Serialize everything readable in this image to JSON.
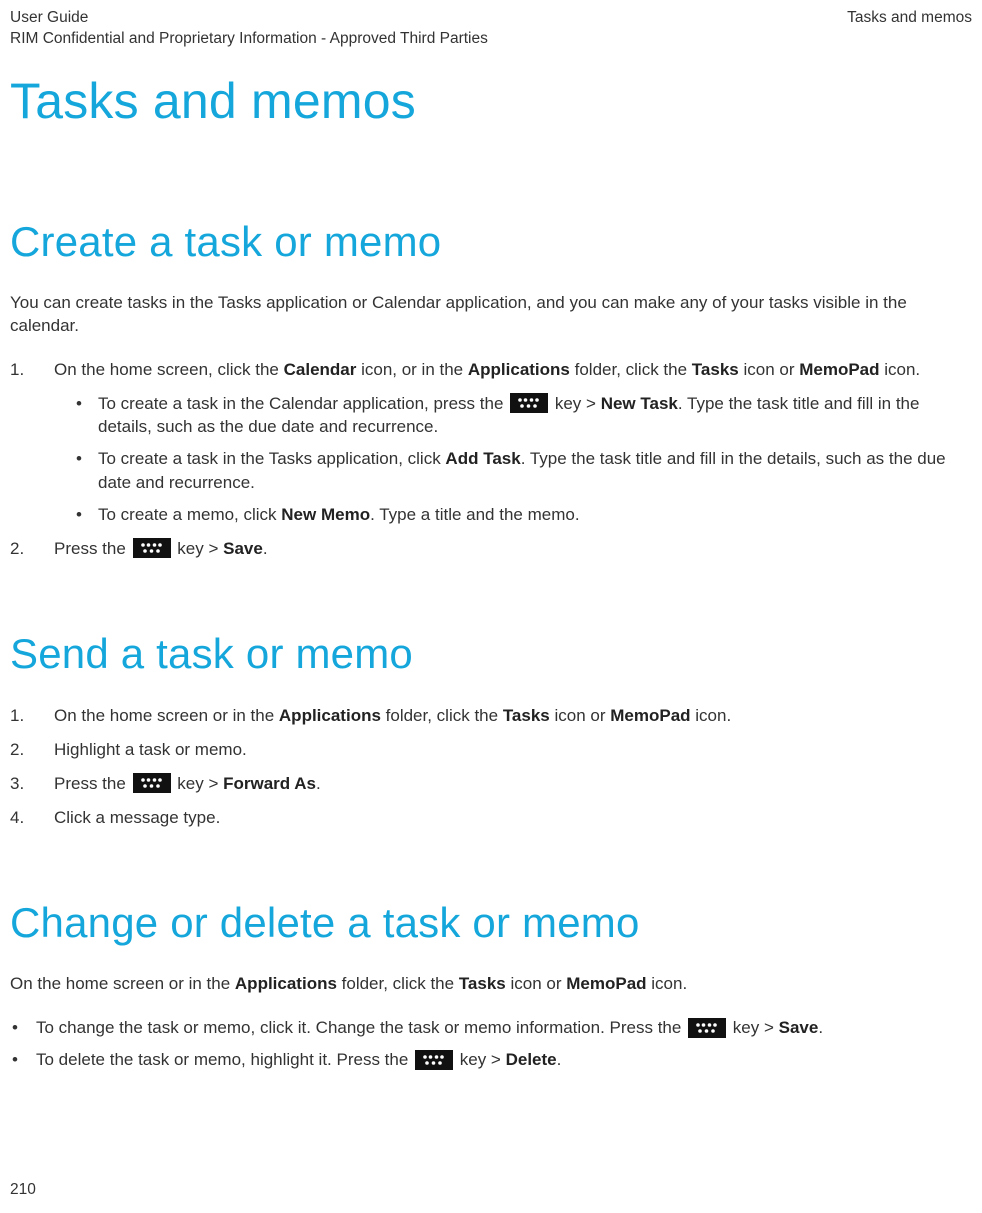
{
  "header": {
    "left_line1": "User Guide",
    "left_line2": "RIM Confidential and Proprietary Information - Approved Third Parties",
    "right": "Tasks and memos"
  },
  "title": "Tasks and memos",
  "sections": {
    "create": {
      "heading": "Create a task or memo",
      "intro": "You can create tasks in the Tasks application or Calendar application, and you can make any of your tasks visible in the calendar.",
      "steps": {
        "s1_a": "On the home screen, click the ",
        "s1_b": "Calendar",
        "s1_c": " icon, or in the ",
        "s1_d": "Applications",
        "s1_e": " folder, click the ",
        "s1_f": "Tasks",
        "s1_g": " icon or ",
        "s1_h": "MemoPad",
        "s1_i": " icon.",
        "sub1_a": "To create a task in the Calendar application, press the ",
        "sub1_b": " key > ",
        "sub1_c": "New Task",
        "sub1_d": ". Type the task title and fill in the details, such as the due date and recurrence.",
        "sub2_a": "To create a task in the Tasks application, click ",
        "sub2_b": "Add Task",
        "sub2_c": ". Type the task title and fill in the details, such as the due date and recurrence.",
        "sub3_a": "To create a memo, click ",
        "sub3_b": "New Memo",
        "sub3_c": ". Type a title and the memo.",
        "s2_a": "Press the ",
        "s2_b": " key > ",
        "s2_c": "Save",
        "s2_d": "."
      }
    },
    "send": {
      "heading": "Send a task or memo",
      "steps": {
        "s1_a": "On the home screen or in the ",
        "s1_b": "Applications",
        "s1_c": " folder, click the ",
        "s1_d": "Tasks",
        "s1_e": " icon or ",
        "s1_f": "MemoPad",
        "s1_g": " icon.",
        "s2": "Highlight a task or memo.",
        "s3_a": "Press the ",
        "s3_b": " key > ",
        "s3_c": "Forward As",
        "s3_d": ".",
        "s4": "Click a message type."
      }
    },
    "change": {
      "heading": "Change or delete a task or memo",
      "intro_a": "On the home screen or in the ",
      "intro_b": "Applications",
      "intro_c": " folder, click the ",
      "intro_d": "Tasks",
      "intro_e": " icon or ",
      "intro_f": "MemoPad",
      "intro_g": " icon.",
      "b1_a": "To change the task or memo, click it. Change the task or memo information. Press the ",
      "b1_b": " key > ",
      "b1_c": "Save",
      "b1_d": ".",
      "b2_a": "To delete the task or memo, highlight it. Press the ",
      "b2_b": " key > ",
      "b2_c": "Delete",
      "b2_d": "."
    }
  },
  "footer": {
    "page_number": "210"
  }
}
